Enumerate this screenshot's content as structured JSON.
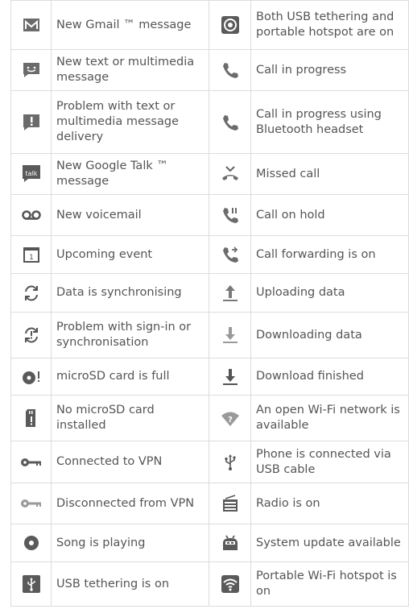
{
  "rows": [
    {
      "left": {
        "icon": "gmail-icon",
        "text": "New Gmail ™ message"
      },
      "right": {
        "icon": "usb-tethering-hotspot-icon",
        "text": "Both USB tethering and portable hotspot are on"
      }
    },
    {
      "left": {
        "icon": "text-message-icon",
        "text": "New text or multimedia message"
      },
      "right": {
        "icon": "call-in-progress-icon",
        "text": "Call in progress"
      }
    },
    {
      "left": {
        "icon": "message-problem-icon",
        "text": "Problem with text or multimedia message delivery"
      },
      "right": {
        "icon": "call-bluetooth-icon",
        "text": "Call in progress using Bluetooth headset"
      }
    },
    {
      "left": {
        "icon": "google-talk-icon",
        "text": "New Google Talk ™ message"
      },
      "right": {
        "icon": "missed-call-icon",
        "text": "Missed call"
      }
    },
    {
      "left": {
        "icon": "voicemail-icon",
        "text": "New voicemail"
      },
      "right": {
        "icon": "call-on-hold-icon",
        "text": "Call on hold"
      }
    },
    {
      "left": {
        "icon": "calendar-icon",
        "text": "Upcoming event"
      },
      "right": {
        "icon": "call-forwarding-icon",
        "text": "Call forwarding is on"
      }
    },
    {
      "left": {
        "icon": "sync-icon",
        "text": "Data is synchronising"
      },
      "right": {
        "icon": "upload-icon",
        "text": "Uploading data"
      }
    },
    {
      "left": {
        "icon": "sync-problem-icon",
        "text": "Problem with sign-in or synchronisation"
      },
      "right": {
        "icon": "download-icon",
        "text": "Downloading data"
      }
    },
    {
      "left": {
        "icon": "sd-card-full-icon",
        "text": "microSD card is full"
      },
      "right": {
        "icon": "download-finished-icon",
        "text": "Download finished"
      }
    },
    {
      "left": {
        "icon": "no-sd-card-icon",
        "text": "No microSD card installed"
      },
      "right": {
        "icon": "open-wifi-icon",
        "text": "An open Wi-Fi network is available"
      }
    },
    {
      "left": {
        "icon": "vpn-connected-icon",
        "text": "Connected to VPN"
      },
      "right": {
        "icon": "usb-icon",
        "text": "Phone is connected via USB cable"
      }
    },
    {
      "left": {
        "icon": "vpn-disconnected-icon",
        "text": "Disconnected from VPN"
      },
      "right": {
        "icon": "radio-icon",
        "text": "Radio is on"
      }
    },
    {
      "left": {
        "icon": "song-playing-icon",
        "text": "Song is playing"
      },
      "right": {
        "icon": "system-update-icon",
        "text": "System update available"
      }
    },
    {
      "left": {
        "icon": "usb-tethering-icon",
        "text": "USB tethering is on"
      },
      "right": {
        "icon": "wifi-hotspot-icon",
        "text": "Portable Wi-Fi hotspot is on"
      }
    }
  ]
}
